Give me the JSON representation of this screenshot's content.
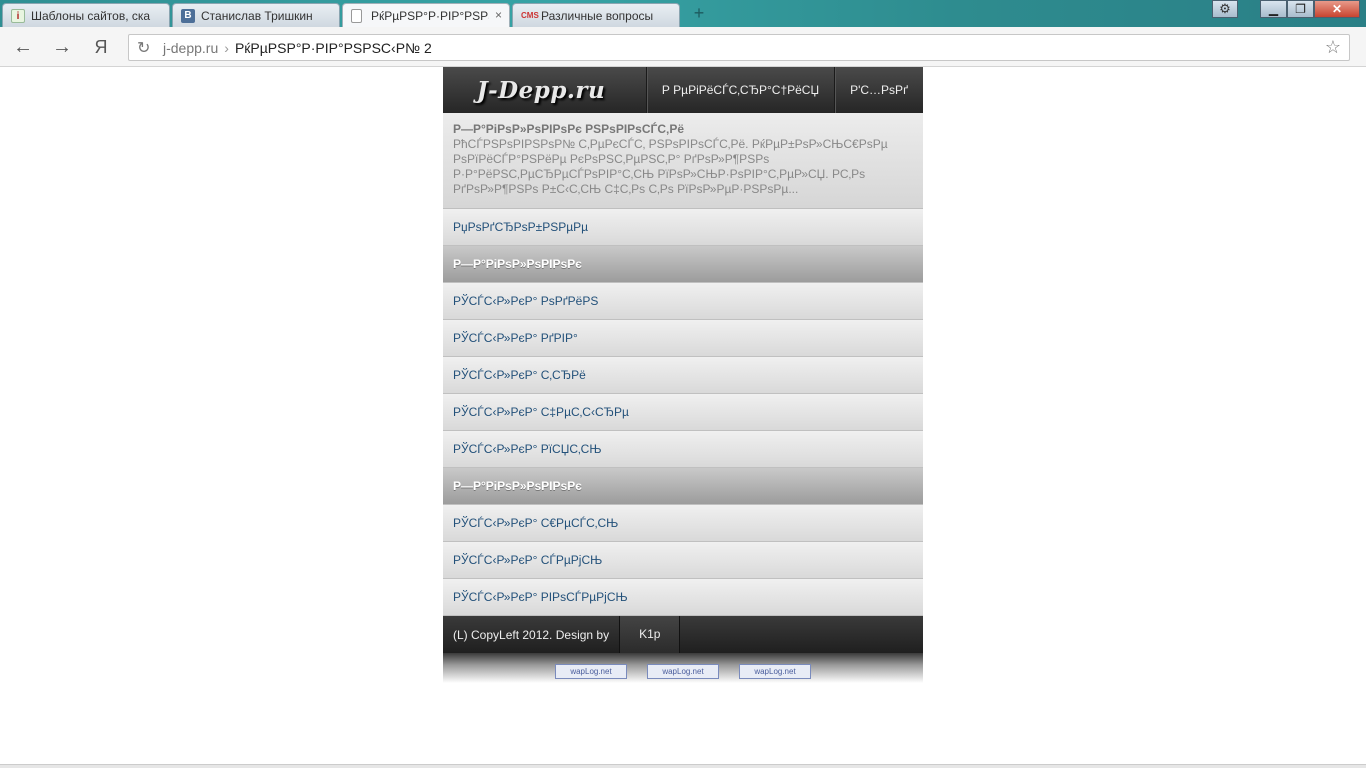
{
  "browser": {
    "tabs": [
      {
        "title": "Шаблоны сайтов, ска",
        "icon": "info-favicon"
      },
      {
        "title": "Станислав Тришкин",
        "icon": "vk-favicon"
      },
      {
        "title": "РќРµРЅР°Р·РІР°РЅРЅС‹Р№ 2",
        "icon": "document-favicon",
        "active": true
      },
      {
        "title": "Различные вопросы",
        "icon": "cms-favicon"
      }
    ],
    "favicon_labels": {
      "info": "i",
      "vk": "В",
      "cms": "CMS"
    },
    "address": {
      "domain": "j-depp.ru",
      "separator": "›",
      "path": "РќРµРЅР°Р·РІР°РЅРЅС‹Р№ 2"
    },
    "buttons": {
      "back": "←",
      "forward": "→",
      "yandex": "Я",
      "reload": "↻",
      "star": "☆",
      "new_tab": "+",
      "close_tab": "×",
      "settings": "⚙",
      "minimize": "▁",
      "maximize": "❐",
      "close": "✕"
    }
  },
  "site": {
    "logo": "J-Depp.ru",
    "nav": [
      "Р РµРіРёСЃС‚СЂР°С†РёСЏ",
      "Р'С…РѕРґ"
    ],
    "intro": {
      "title": "Р—Р°РіРѕР»РѕРІРѕРє РЅРѕРІРѕСЃС‚Рё",
      "text": "РћСЃРЅРѕРІРЅРѕР№ С‚РµРєСЃС‚ РЅРѕРІРѕСЃС‚Рё. РќРµР±РѕР»СЊС€РѕРµ РѕРїРёСЃР°РЅРёРµ РєРѕРЅС‚РµРЅС‚Р° РґРѕР»Р¶РЅРѕ Р·Р°РёРЅС‚РµСЂРµСЃРѕРІР°С‚СЊ РїРѕР»СЊР·РѕРІР°С‚РµР»СЏ. РС‚Рѕ РґРѕР»Р¶РЅРѕ Р±С‹С‚СЊ С‡С‚Рѕ С‚Рѕ РїРѕР»РµР·РЅРѕРµ..."
    },
    "rows": [
      {
        "label": "РџРѕРґСЂРѕР±РЅРµРµ",
        "type": "link"
      },
      {
        "label": "Р—Р°РіРѕР»РѕРІРѕРє",
        "type": "section"
      },
      {
        "label": "РЎСЃС‹Р»РєР° РѕРґРёРЅ",
        "type": "link"
      },
      {
        "label": "РЎСЃС‹Р»РєР° РґРІР°",
        "type": "link"
      },
      {
        "label": "РЎСЃС‹Р»РєР° С‚СЂРё",
        "type": "link"
      },
      {
        "label": "РЎСЃС‹Р»РєР° С‡РµС‚С‹СЂРµ",
        "type": "link"
      },
      {
        "label": "РЎСЃС‹Р»РєР° РїСЏС‚СЊ",
        "type": "link"
      },
      {
        "label": "Р—Р°РіРѕР»РѕРІРѕРє",
        "type": "section"
      },
      {
        "label": "РЎСЃС‹Р»РєР° С€РµСЃС‚СЊ",
        "type": "link"
      },
      {
        "label": "РЎСЃС‹Р»РєР° СЃРµРјСЊ",
        "type": "link"
      },
      {
        "label": "РЎСЃС‹Р»РєР° РІРѕСЃРµРјСЊ",
        "type": "link"
      }
    ],
    "footer": {
      "copy": "(L) CopyLeft 2012. Design by",
      "author": "K1p"
    },
    "counters": [
      "wapLog.net",
      "wapLog.net",
      "wapLog.net"
    ]
  }
}
